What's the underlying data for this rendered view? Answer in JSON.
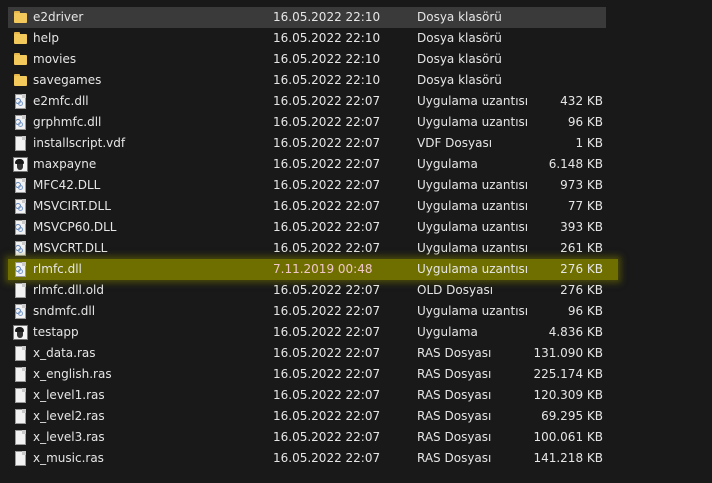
{
  "files": [
    {
      "name": "e2driver",
      "date": "16.05.2022 22:10",
      "type": "Dosya klasörü",
      "size": "",
      "icon": "folder-icon",
      "state": "selected"
    },
    {
      "name": "help",
      "date": "16.05.2022 22:10",
      "type": "Dosya klasörü",
      "size": "",
      "icon": "folder-icon",
      "state": ""
    },
    {
      "name": "movies",
      "date": "16.05.2022 22:10",
      "type": "Dosya klasörü",
      "size": "",
      "icon": "folder-icon",
      "state": ""
    },
    {
      "name": "savegames",
      "date": "16.05.2022 22:10",
      "type": "Dosya klasörü",
      "size": "",
      "icon": "folder-icon",
      "state": ""
    },
    {
      "name": "e2mfc.dll",
      "date": "16.05.2022 22:07",
      "type": "Uygulama uzantısı",
      "size": "432 KB",
      "icon": "dll-file-icon",
      "state": ""
    },
    {
      "name": "grphmfc.dll",
      "date": "16.05.2022 22:07",
      "type": "Uygulama uzantısı",
      "size": "96 KB",
      "icon": "dll-file-icon",
      "state": ""
    },
    {
      "name": "installscript.vdf",
      "date": "16.05.2022 22:07",
      "type": "VDF Dosyası",
      "size": "1 KB",
      "icon": "file-icon",
      "state": ""
    },
    {
      "name": "maxpayne",
      "date": "16.05.2022 22:07",
      "type": "Uygulama",
      "size": "6.148 KB",
      "icon": "app-icon",
      "state": ""
    },
    {
      "name": "MFC42.DLL",
      "date": "16.05.2022 22:07",
      "type": "Uygulama uzantısı",
      "size": "973 KB",
      "icon": "dll-file-icon",
      "state": ""
    },
    {
      "name": "MSVCIRT.DLL",
      "date": "16.05.2022 22:07",
      "type": "Uygulama uzantısı",
      "size": "77 KB",
      "icon": "dll-file-icon",
      "state": ""
    },
    {
      "name": "MSVCP60.DLL",
      "date": "16.05.2022 22:07",
      "type": "Uygulama uzantısı",
      "size": "393 KB",
      "icon": "dll-file-icon",
      "state": ""
    },
    {
      "name": "MSVCRT.DLL",
      "date": "16.05.2022 22:07",
      "type": "Uygulama uzantısı",
      "size": "261 KB",
      "icon": "dll-file-icon",
      "state": ""
    },
    {
      "name": "rlmfc.dll",
      "date": "7.11.2019 00:48",
      "type": "Uygulama uzantısı",
      "size": "276 KB",
      "icon": "dll-file-icon",
      "state": "highlighted"
    },
    {
      "name": "rlmfc.dll.old",
      "date": "16.05.2022 22:07",
      "type": "OLD Dosyası",
      "size": "276 KB",
      "icon": "file-icon",
      "state": ""
    },
    {
      "name": "sndmfc.dll",
      "date": "16.05.2022 22:07",
      "type": "Uygulama uzantısı",
      "size": "96 KB",
      "icon": "dll-file-icon",
      "state": ""
    },
    {
      "name": "testapp",
      "date": "16.05.2022 22:07",
      "type": "Uygulama",
      "size": "4.836 KB",
      "icon": "app-icon",
      "state": ""
    },
    {
      "name": "x_data.ras",
      "date": "16.05.2022 22:07",
      "type": "RAS Dosyası",
      "size": "131.090 KB",
      "icon": "file-icon",
      "state": ""
    },
    {
      "name": "x_english.ras",
      "date": "16.05.2022 22:07",
      "type": "RAS Dosyası",
      "size": "225.174 KB",
      "icon": "file-icon",
      "state": ""
    },
    {
      "name": "x_level1.ras",
      "date": "16.05.2022 22:07",
      "type": "RAS Dosyası",
      "size": "120.309 KB",
      "icon": "file-icon",
      "state": ""
    },
    {
      "name": "x_level2.ras",
      "date": "16.05.2022 22:07",
      "type": "RAS Dosyası",
      "size": "69.295 KB",
      "icon": "file-icon",
      "state": ""
    },
    {
      "name": "x_level3.ras",
      "date": "16.05.2022 22:07",
      "type": "RAS Dosyası",
      "size": "100.061 KB",
      "icon": "file-icon",
      "state": ""
    },
    {
      "name": "x_music.ras",
      "date": "16.05.2022 22:07",
      "type": "RAS Dosyası",
      "size": "141.218 KB",
      "icon": "file-icon",
      "state": ""
    }
  ]
}
